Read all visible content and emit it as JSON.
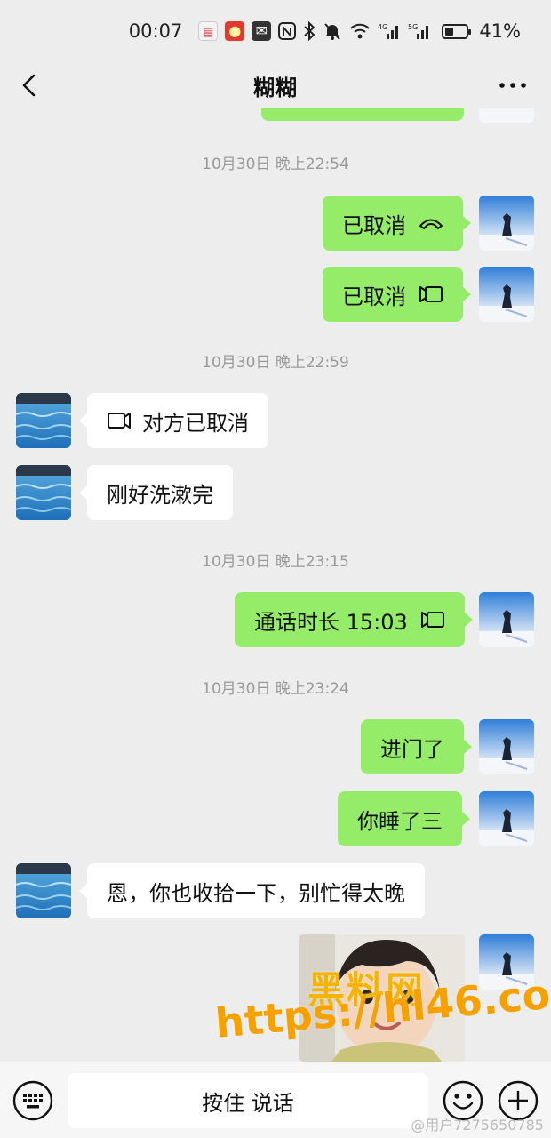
{
  "status_bar": {
    "time": "00:07",
    "battery": "41%",
    "battery_level": 0.41,
    "signal_tags": [
      "4G",
      "5G"
    ],
    "icons": [
      "app-notification-icon",
      "app-notification-icon",
      "mail-icon",
      "nfc-icon",
      "bluetooth-icon",
      "mute-icon",
      "wifi-icon",
      "signal-icon",
      "signal-icon",
      "battery-icon"
    ]
  },
  "header": {
    "title": "糊糊",
    "back_icon": "chevron-left-icon",
    "more_icon": "more-dots-icon"
  },
  "messages": [
    {
      "type": "timestamp",
      "text": "10月30日 晚上22:54"
    },
    {
      "type": "call",
      "from": "me",
      "text": "已取消",
      "icon": "voice-call-icon"
    },
    {
      "type": "call",
      "from": "me",
      "text": "已取消",
      "icon": "video-call-icon"
    },
    {
      "type": "timestamp",
      "text": "10月30日 晚上22:59"
    },
    {
      "type": "call",
      "from": "them",
      "text": "对方已取消",
      "icon": "video-call-icon"
    },
    {
      "type": "text",
      "from": "them",
      "text": "刚好洗漱完"
    },
    {
      "type": "timestamp",
      "text": "10月30日 晚上23:15"
    },
    {
      "type": "call",
      "from": "me",
      "text": "通话时长 15:03",
      "icon": "video-call-icon"
    },
    {
      "type": "timestamp",
      "text": "10月30日 晚上23:24"
    },
    {
      "type": "text",
      "from": "me",
      "text": "进门了"
    },
    {
      "type": "text",
      "from": "me",
      "text": "你睡了三"
    },
    {
      "type": "text",
      "from": "them",
      "text": "恩，你也收拾一下，别忙得太晚"
    },
    {
      "type": "sticker",
      "from": "me",
      "description_icon": "toddler-sticker-image"
    }
  ],
  "watermark": {
    "cn": "黑料网",
    "url": "https://hl46.co"
  },
  "input_bar": {
    "hold_to_talk": "按住 说话",
    "keyboard_icon": "keyboard-icon",
    "emoji_icon": "emoji-icon",
    "plus_icon": "plus-icon"
  },
  "credit": "@用户7275650785",
  "colors": {
    "background": "#ededed",
    "my_bubble": "#95ec69",
    "their_bubble": "#ffffff",
    "timestamp": "#9a9a9a",
    "watermark": "#f5b400"
  }
}
